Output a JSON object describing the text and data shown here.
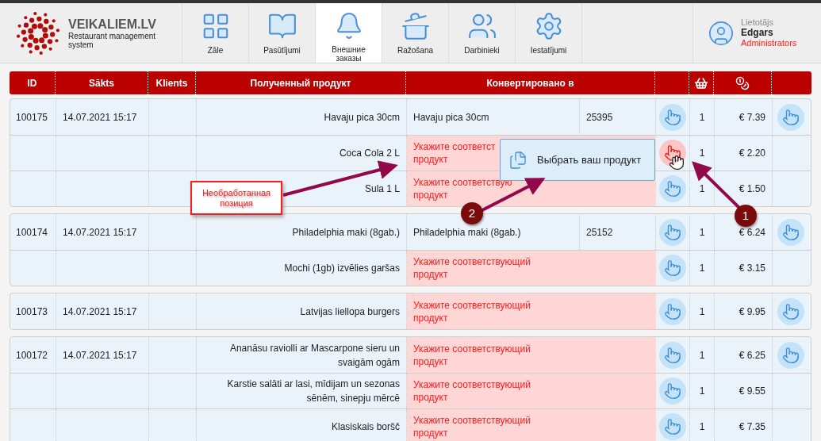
{
  "brand": {
    "name": "VEIKALIEM.LV",
    "tagline": "Restaurant management system"
  },
  "nav": [
    {
      "label": "Zāle",
      "selected": false
    },
    {
      "label": "Pasūtījumi",
      "selected": false
    },
    {
      "label": "Внешние заказы",
      "selected": true
    },
    {
      "label": "Ražošana",
      "selected": false
    },
    {
      "label": "Darbinieki",
      "selected": false
    },
    {
      "label": "Iestatījumi",
      "selected": false
    }
  ],
  "user": {
    "caption": "Lietotājs",
    "name": "Edgars",
    "role": "Administrators"
  },
  "table": {
    "columns": [
      "ID",
      "Sākts",
      "Klients",
      "Полученный продукт",
      "Конвертировано в"
    ],
    "orders": [
      {
        "id": "100175",
        "started": "14.07.2021 15:17",
        "items": [
          {
            "product": "Havaju pica 30cm",
            "kind": "matched",
            "converted": "Havaju pica 30cm",
            "code": "25395",
            "qty": "1",
            "price": "€ 7.39",
            "active": false
          },
          {
            "product": "Coca Cola 2 L",
            "kind": "unmatched",
            "converted": "Укажите соответст\nпродукт",
            "qty": "1",
            "price": "€ 2.20",
            "active": true
          },
          {
            "product": "Sula 1 L",
            "kind": "unmatched",
            "converted": "Укажите соответствую\nпродукт",
            "qty": "1",
            "price": "€ 1.50",
            "active": false
          }
        ]
      },
      {
        "id": "100174",
        "started": "14.07.2021 15:17",
        "items": [
          {
            "product": "Philadelphia maki (8gab.)",
            "kind": "matched",
            "converted": "Philadelphia maki (8gab.)",
            "code": "25152",
            "qty": "1",
            "price": "€ 6.24",
            "active": false
          },
          {
            "product": "Mochi (1gb) izvēlies garšas",
            "kind": "unmatched",
            "converted": "Укажите соответствующий продукт",
            "qty": "1",
            "price": "€ 3.15",
            "active": false
          }
        ]
      },
      {
        "id": "100173",
        "started": "14.07.2021 15:17",
        "items": [
          {
            "product": "Latvijas liellopa burgers",
            "kind": "unmatched",
            "converted": "Укажите соответствующий продукт",
            "qty": "1",
            "price": "€ 9.95",
            "active": false
          }
        ]
      },
      {
        "id": "100172",
        "started": "14.07.2021 15:17",
        "items": [
          {
            "product": "Ananāsu raviolli ar Mascarpone sieru un svaigām ogām",
            "kind": "unmatched",
            "converted": "Укажите соответствующий продукт",
            "qty": "1",
            "price": "€ 6.25",
            "active": false
          },
          {
            "product": "Karstie salāti ar lasi, mīdijam un sezonas sēnēm, sinepju mērcē",
            "kind": "unmatched",
            "converted": "Укажите соответствующий продукт",
            "qty": "1",
            "price": "€ 9.55",
            "active": false
          },
          {
            "product": "Klasiskais boršč",
            "kind": "unmatched",
            "converted": "Укажите соответствующий продукт",
            "qty": "1",
            "price": "€ 7.35",
            "active": false
          }
        ]
      }
    ]
  },
  "annotations": {
    "callout": "Необработанная позиция",
    "markers": [
      "2",
      "1"
    ],
    "tooltip": "Выбрать ваш продукт"
  }
}
